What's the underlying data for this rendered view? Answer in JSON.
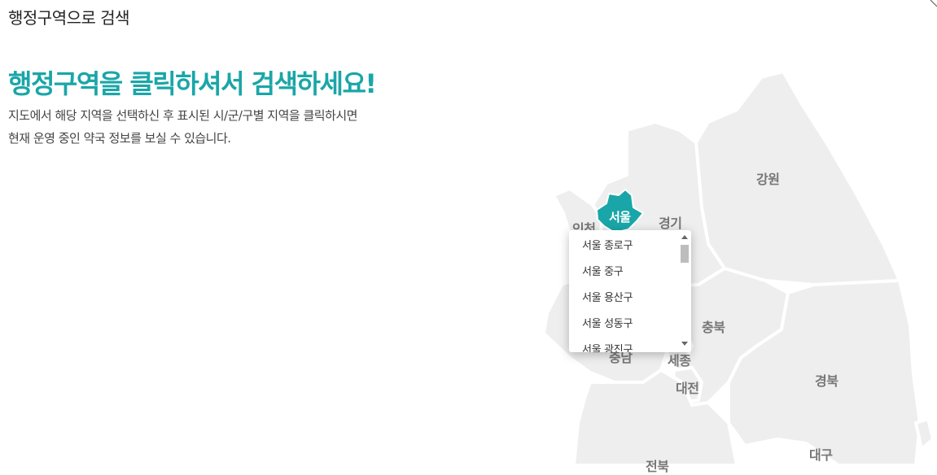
{
  "header": {
    "title": "행정구역으로 검색"
  },
  "main": {
    "headline": "행정구역을 클릭하셔서 검색하세요!",
    "description_line1": "지도에서 해당 지역을 선택하신 후 표시된 시/군/구별 지역을 클릭하시면",
    "description_line2": "현재 운영 중인 약국 정보를 보실 수 있습니다."
  },
  "map": {
    "selected_region": "서울",
    "regions": [
      {
        "label": "강원"
      },
      {
        "label": "경기"
      },
      {
        "label": "인천"
      },
      {
        "label": "충북"
      },
      {
        "label": "충남"
      },
      {
        "label": "세종"
      },
      {
        "label": "대전"
      },
      {
        "label": "경북"
      },
      {
        "label": "대구"
      },
      {
        "label": "전북"
      }
    ],
    "colors": {
      "land": "#eeeeee",
      "border": "#ffffff",
      "selected": "#1aa6a8",
      "label": "#777777"
    }
  },
  "dropdown": {
    "items": [
      "서울 종로구",
      "서울 중구",
      "서울 용산구",
      "서울 성동구",
      "서울 광진구"
    ]
  }
}
